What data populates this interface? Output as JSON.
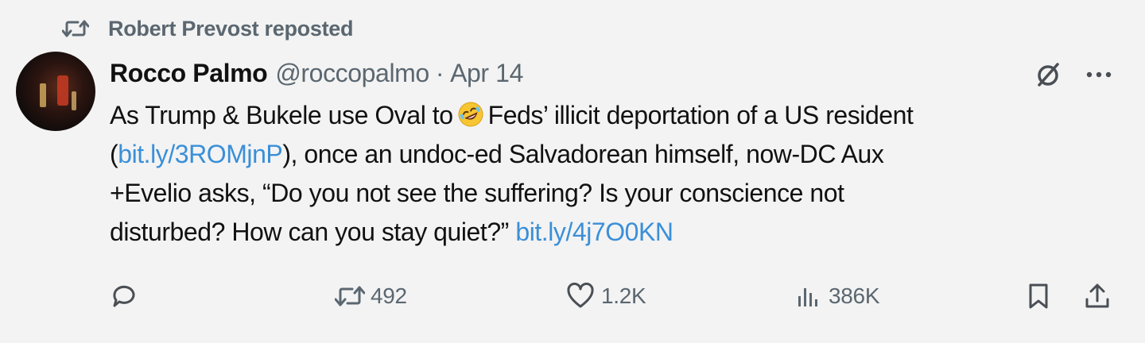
{
  "repost": {
    "text": "Robert Prevost reposted",
    "icon": "repost-icon"
  },
  "author": {
    "name": "Rocco Palmo",
    "handle": "@roccopalmo",
    "separator": "·",
    "date": "Apr 14",
    "avatar": "avatar-image"
  },
  "tweet": {
    "line1_a": "As Trump & Bukele use Oval to",
    "emoji": "rolling-on-floor-laughing-emoji",
    "line1_b": "Feds’ illicit deportation of a US resident",
    "line2_open": "(",
    "line2_link": "bit.ly/3ROMjnP",
    "line2_rest": "), once an undoc-ed Salvadorean himself, now-DC Aux",
    "line3": "+Evelio asks, “Do you not see the suffering? Is your conscience not",
    "line4_text": "disturbed? How can you stay quiet?”",
    "line4_link": "bit.ly/4j7O0KN"
  },
  "actions": {
    "reply_count": "",
    "repost_count": "492",
    "like_count": "1.2K",
    "views_count": "386K"
  },
  "colors": {
    "background": "#f3f3f3",
    "text": "#111111",
    "muted": "#5b6770",
    "link": "#3a8fd8"
  }
}
